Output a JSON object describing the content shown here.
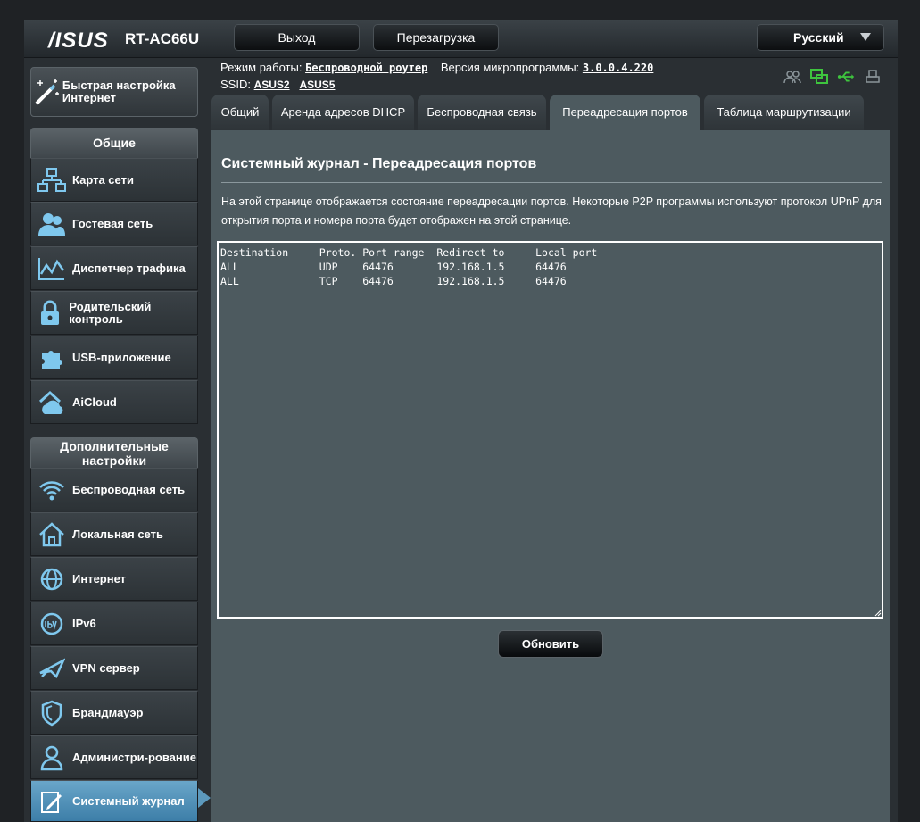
{
  "header": {
    "logo": "/ISUS",
    "model": "RT-AC66U",
    "logout_label": "Выход",
    "reboot_label": "Перезагрузка",
    "language": "Русский"
  },
  "status": {
    "mode_label": "Режим работы:",
    "mode_value": "Беспроводной роутер",
    "firmware_label": "Версия микропрограммы:",
    "firmware_value": "3.0.0.4.220",
    "ssid_label": "SSID:",
    "ssid1": "ASUS2",
    "ssid2": "ASUS5"
  },
  "sidebar": {
    "quick_setup": "Быстрая настройка Интернет",
    "general_title": "Общие",
    "general_items": [
      {
        "label": "Карта сети",
        "icon": "network-map-icon"
      },
      {
        "label": "Гостевая сеть",
        "icon": "guest-network-icon"
      },
      {
        "label": "Диспетчер трафика",
        "icon": "traffic-manager-icon"
      },
      {
        "label": "Родительский контроль",
        "icon": "parental-control-icon"
      },
      {
        "label": "USB-приложение",
        "icon": "usb-app-icon"
      },
      {
        "label": "AiCloud",
        "icon": "aicloud-icon"
      }
    ],
    "advanced_title": "Дополнительные настройки",
    "advanced_items": [
      {
        "label": "Беспроводная сеть",
        "icon": "wireless-icon"
      },
      {
        "label": "Локальная сеть",
        "icon": "lan-icon"
      },
      {
        "label": "Интернет",
        "icon": "internet-icon"
      },
      {
        "label": "IPv6",
        "icon": "ipv6-icon"
      },
      {
        "label": "VPN сервер",
        "icon": "vpn-icon"
      },
      {
        "label": "Брандмауэр",
        "icon": "firewall-icon"
      },
      {
        "label": "Администри-рование",
        "icon": "admin-icon"
      },
      {
        "label": "Системный журнал",
        "icon": "system-log-icon"
      }
    ]
  },
  "tabs": [
    {
      "label": "Общий"
    },
    {
      "label": "Аренда адресов DHCP"
    },
    {
      "label": "Беспроводная связь"
    },
    {
      "label": "Переадресация портов"
    },
    {
      "label": "Таблица маршрутизации"
    }
  ],
  "main": {
    "title": "Системный журнал - Переадресация портов",
    "description": "На этой странице отображается состояние переадресации портов. Некоторые P2P программы используют протокол UPnP для открытия порта и номера порта будет отображен на этой странице.",
    "log_text": "Destination     Proto. Port range  Redirect to     Local port\nALL             UDP    64476       192.168.1.5     64476\nALL             TCP    64476       192.168.1.5     64476",
    "refresh_label": "Обновить"
  }
}
